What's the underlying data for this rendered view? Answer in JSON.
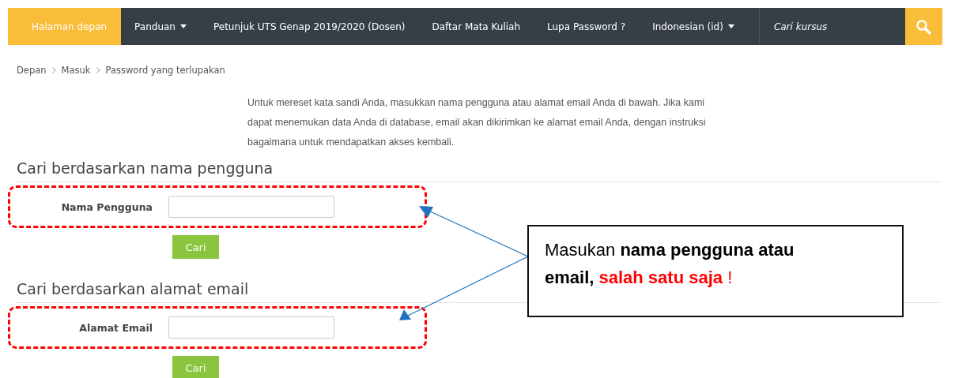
{
  "navbar": {
    "items": [
      {
        "label": "Halaman depan",
        "selected": true,
        "dropdown": false
      },
      {
        "label": "Panduan",
        "selected": false,
        "dropdown": true
      },
      {
        "label": "Petunjuk UTS Genap 2019/2020 (Dosen)",
        "selected": false,
        "dropdown": false
      },
      {
        "label": "Daftar Mata Kuliah",
        "selected": false,
        "dropdown": false
      },
      {
        "label": "Lupa Password ?",
        "selected": false,
        "dropdown": false
      },
      {
        "label": "Indonesian (id)",
        "selected": false,
        "dropdown": true
      }
    ],
    "search": {
      "placeholder": "Cari kursus"
    }
  },
  "breadcrumb": [
    "Depan",
    "Masuk",
    "Password yang terlupakan"
  ],
  "intro": "Untuk mereset kata sandi Anda, masukkan nama pengguna atau alamat email Anda di bawah. Jika kami dapat menemukan data Anda di database, email akan dikirimkan ke alamat email Anda, dengan instruksi bagaimana untuk mendapatkan akses kembali.",
  "sections": [
    {
      "heading": "Cari berdasarkan nama pengguna",
      "label": "Nama Pengguna",
      "button": "Cari"
    },
    {
      "heading": "Cari berdasarkan alamat email",
      "label": "Alamat Email",
      "button": "Cari"
    }
  ],
  "callout": {
    "text": "Masukan **nama pengguna atau email,**",
    "highlight": "salah satu saja",
    "end": "!"
  }
}
